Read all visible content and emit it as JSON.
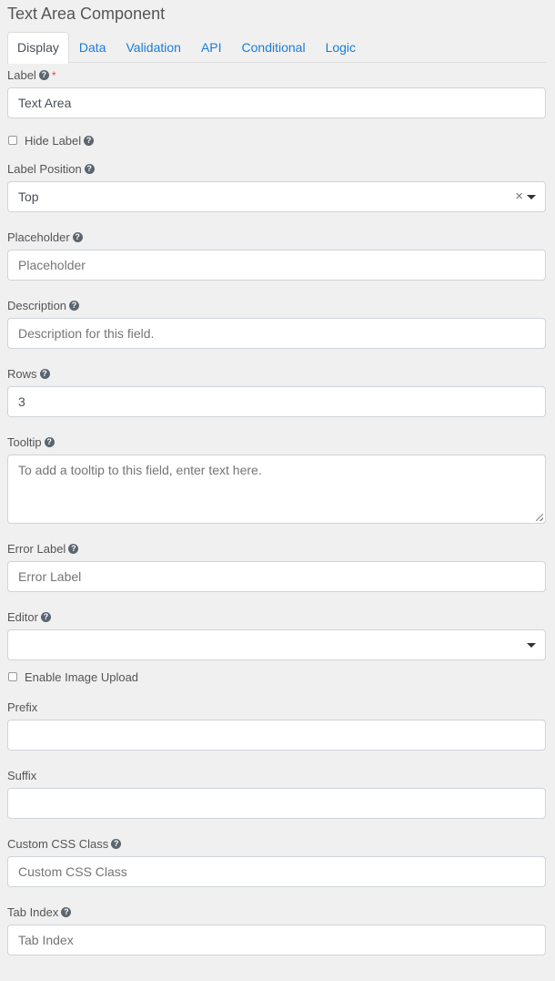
{
  "title": "Text Area Component",
  "tabs": [
    {
      "label": "Display",
      "active": true
    },
    {
      "label": "Data"
    },
    {
      "label": "Validation"
    },
    {
      "label": "API"
    },
    {
      "label": "Conditional"
    },
    {
      "label": "Logic"
    }
  ],
  "help_glyph": "?",
  "required_mark": "*",
  "clear_glyph": "×",
  "fields": {
    "label": {
      "label": "Label",
      "value": "Text Area"
    },
    "hide_label": {
      "label": "Hide Label",
      "checked": false
    },
    "label_position": {
      "label": "Label Position",
      "value": "Top"
    },
    "placeholder": {
      "label": "Placeholder",
      "placeholder": "Placeholder"
    },
    "description": {
      "label": "Description",
      "placeholder": "Description for this field."
    },
    "rows": {
      "label": "Rows",
      "value": "3"
    },
    "tooltip": {
      "label": "Tooltip",
      "placeholder": "To add a tooltip to this field, enter text here."
    },
    "error_label": {
      "label": "Error Label",
      "placeholder": "Error Label"
    },
    "editor": {
      "label": "Editor",
      "value": ""
    },
    "enable_image_upload": {
      "label": "Enable Image Upload",
      "checked": false
    },
    "prefix": {
      "label": "Prefix",
      "value": ""
    },
    "suffix": {
      "label": "Suffix",
      "value": ""
    },
    "custom_css_class": {
      "label": "Custom CSS Class",
      "placeholder": "Custom CSS Class"
    },
    "tab_index": {
      "label": "Tab Index",
      "placeholder": "Tab Index"
    }
  },
  "colors": {
    "accent": "#1a7cd8",
    "required": "#e74c3c",
    "background": "#f0f0f0"
  }
}
